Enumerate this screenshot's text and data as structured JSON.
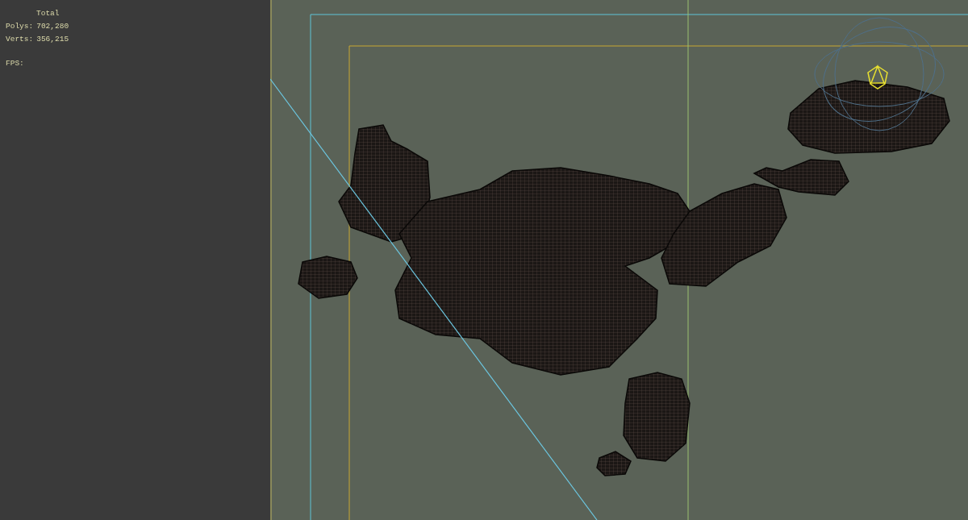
{
  "stats": {
    "title": "Total",
    "rows": [
      {
        "label": "Polys:",
        "value": "702,280"
      },
      {
        "label": "Verts:",
        "value": "356,215"
      }
    ],
    "fps_label": "FPS:"
  }
}
